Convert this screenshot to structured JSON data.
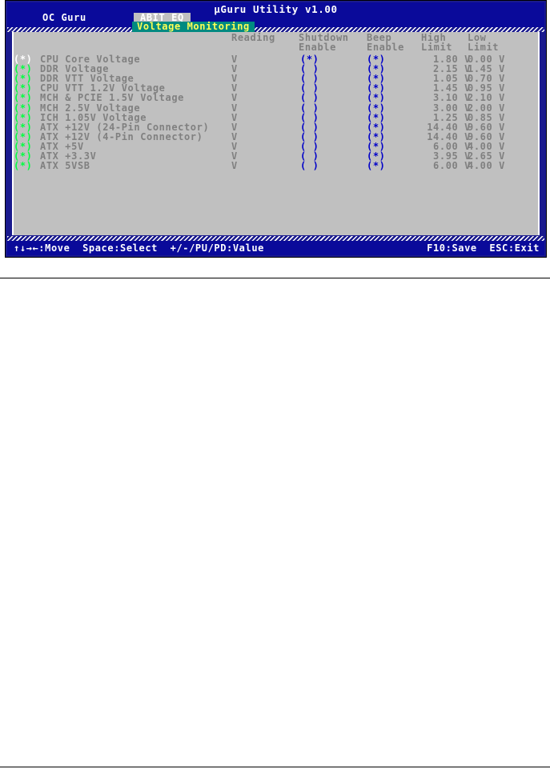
{
  "app": {
    "title": "µGuru Utility v1.00",
    "menu_oc": "OC Guru",
    "menu_abit": "ABIT EQ",
    "tab": "Voltage Monitoring"
  },
  "columns": {
    "reading": "Reading",
    "shutdown_1": "Shutdown",
    "shutdown_2": "Enable",
    "beep_1": "Beep",
    "beep_2": "Enable",
    "high_1": "High",
    "high_2": "Limit",
    "low_1": "Low",
    "low_2": "Limit"
  },
  "rows": [
    {
      "sel": "(*)",
      "name": "CPU Core Voltage",
      "reading": "V",
      "shutdown": "(*)",
      "beep": "(*)",
      "high": "1.80 V",
      "low": "0.00 V"
    },
    {
      "sel": "(*)",
      "name": "DDR Voltage",
      "reading": "V",
      "shutdown": "( )",
      "beep": "(*)",
      "high": "2.15 V",
      "low": "1.45 V"
    },
    {
      "sel": "(*)",
      "name": "DDR VTT Voltage",
      "reading": "V",
      "shutdown": "( )",
      "beep": "(*)",
      "high": "1.05 V",
      "low": "0.70 V"
    },
    {
      "sel": "(*)",
      "name": "CPU VTT 1.2V Voltage",
      "reading": "V",
      "shutdown": "( )",
      "beep": "(*)",
      "high": "1.45 V",
      "low": "0.95 V"
    },
    {
      "sel": "(*)",
      "name": "MCH & PCIE 1.5V Voltage",
      "reading": "V",
      "shutdown": "( )",
      "beep": "(*)",
      "high": "3.10 V",
      "low": "2.10 V"
    },
    {
      "sel": "(*)",
      "name": "MCH 2.5V Voltage",
      "reading": "V",
      "shutdown": "( )",
      "beep": "(*)",
      "high": "3.00 V",
      "low": "2.00 V"
    },
    {
      "sel": "(*)",
      "name": "ICH 1.05V Voltage",
      "reading": "V",
      "shutdown": "( )",
      "beep": "(*)",
      "high": "1.25 V",
      "low": "0.85 V"
    },
    {
      "sel": "(*)",
      "name": "ATX +12V (24-Pin Connector)",
      "reading": "V",
      "shutdown": "( )",
      "beep": "(*)",
      "high": "14.40 V",
      "low": "9.60 V"
    },
    {
      "sel": "(*)",
      "name": "ATX +12V (4-Pin Connector)",
      "reading": "V",
      "shutdown": "( )",
      "beep": "(*)",
      "high": "14.40 V",
      "low": "9.60 V"
    },
    {
      "sel": "(*)",
      "name": "ATX +5V",
      "reading": "V",
      "shutdown": "( )",
      "beep": "(*)",
      "high": "6.00 V",
      "low": "4.00 V"
    },
    {
      "sel": "(*)",
      "name": "ATX +3.3V",
      "reading": "V",
      "shutdown": "( )",
      "beep": "(*)",
      "high": "3.95 V",
      "low": "2.65 V"
    },
    {
      "sel": "(*)",
      "name": "ATX 5VSB",
      "reading": "V",
      "shutdown": "( )",
      "beep": "(*)",
      "high": "6.00 V",
      "low": "4.00 V"
    }
  ],
  "status": {
    "left": "↑↓→←:Move  Space:Select  +/-/PU/PD:Value",
    "right": "F10:Save  ESC:Exit"
  },
  "colors": {
    "screen_bg": "#1a1a8e",
    "panel_bg": "#c0c0c0",
    "selected_marker": "#00ff40",
    "radio_color": "#0000c8",
    "tab_bg": "#008a80",
    "tab_text": "#ffff55"
  }
}
